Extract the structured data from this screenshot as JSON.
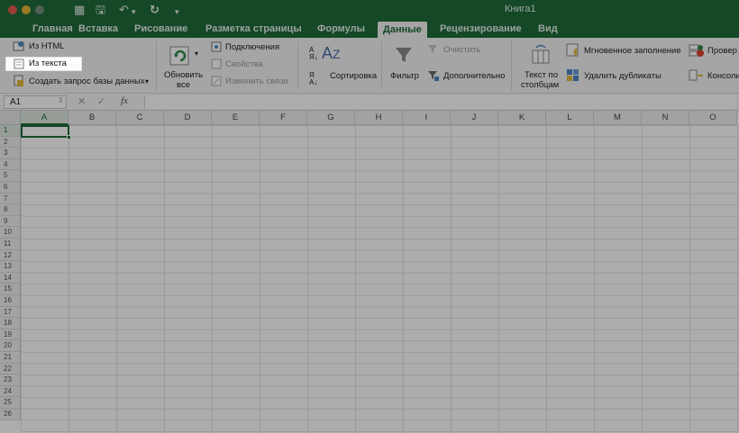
{
  "window": {
    "title": "Книга1"
  },
  "quick_access": {
    "icons": [
      "grid-icon",
      "save-icon",
      "undo-icon",
      "redo-icon",
      "customize-icon"
    ]
  },
  "tabs": [
    {
      "label": "Главная"
    },
    {
      "label": "Вставка"
    },
    {
      "label": "Рисование"
    },
    {
      "label": "Разметка страницы"
    },
    {
      "label": "Формулы"
    },
    {
      "label": "Данные",
      "active": true
    },
    {
      "label": "Рецензирование"
    },
    {
      "label": "Вид"
    }
  ],
  "ribbon": {
    "get_data": {
      "from_html": "Из HTML",
      "from_text": "Из текста",
      "new_db_query": "Создать запрос базы данных"
    },
    "refresh": {
      "label_line1": "Обновить",
      "label_line2": "все"
    },
    "connections": {
      "connections": "Подключения",
      "properties": "Свойства",
      "edit_links": "Изменить связи"
    },
    "sort": {
      "sort": "Сортировка"
    },
    "filter": {
      "filter": "Фильтр",
      "clear": "Очистить",
      "advanced": "Дополнительно"
    },
    "text_to_columns": {
      "line1": "Текст по",
      "line2": "столбцам"
    },
    "tools": {
      "flash_fill": "Мгновенное заполнение",
      "remove_duplicates": "Удалить дубликаты",
      "data_validation": "Провер",
      "consolidate": "Консоли"
    }
  },
  "formula_bar": {
    "name_box": "A1",
    "fx": "fx",
    "value": ""
  },
  "sheet": {
    "columns": [
      "A",
      "B",
      "C",
      "D",
      "E",
      "F",
      "G",
      "H",
      "I",
      "J",
      "K",
      "L",
      "M",
      "N",
      "O"
    ],
    "rows": [
      "1",
      "2",
      "3",
      "4",
      "5",
      "6",
      "7",
      "8",
      "9",
      "10",
      "11",
      "12",
      "13",
      "14",
      "15",
      "16",
      "17",
      "18",
      "19",
      "20",
      "21",
      "22",
      "23",
      "24",
      "25",
      "26"
    ],
    "active_cell": "A1"
  },
  "colors": {
    "accent": "#1e6b3a",
    "ribbon_bg": "#f3f3f3"
  }
}
